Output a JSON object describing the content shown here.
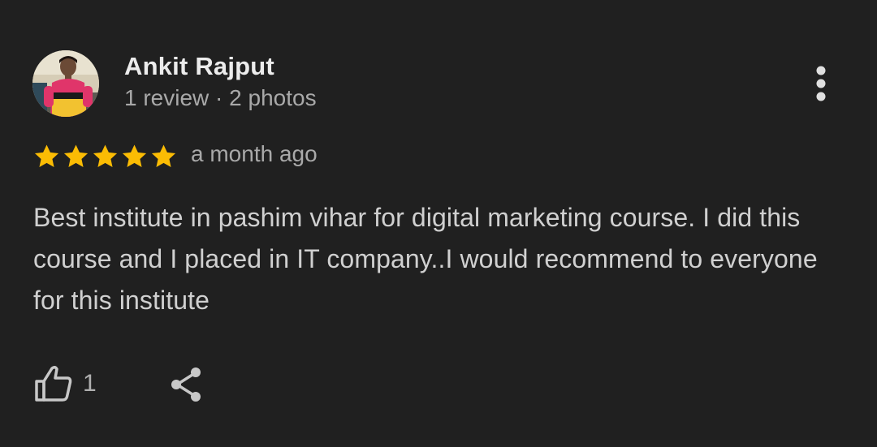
{
  "review": {
    "author_name": "Ankit Rajput",
    "author_meta": "1 review · 2 photos",
    "rating": 5,
    "rating_max": 5,
    "time": "a month ago",
    "text": "Best institute in pashim vihar for digital marketing course. I did this course and I placed in IT company..I would recommend to everyone for this institute",
    "like_count": "1"
  },
  "icons": {
    "more": "more-vertical-icon",
    "star": "star-icon",
    "like": "thumbs-up-icon",
    "share": "share-icon"
  },
  "colors": {
    "background": "#202020",
    "star": "#fbbc04",
    "primary_text": "#ececec",
    "secondary_text": "#a9a9a9"
  }
}
